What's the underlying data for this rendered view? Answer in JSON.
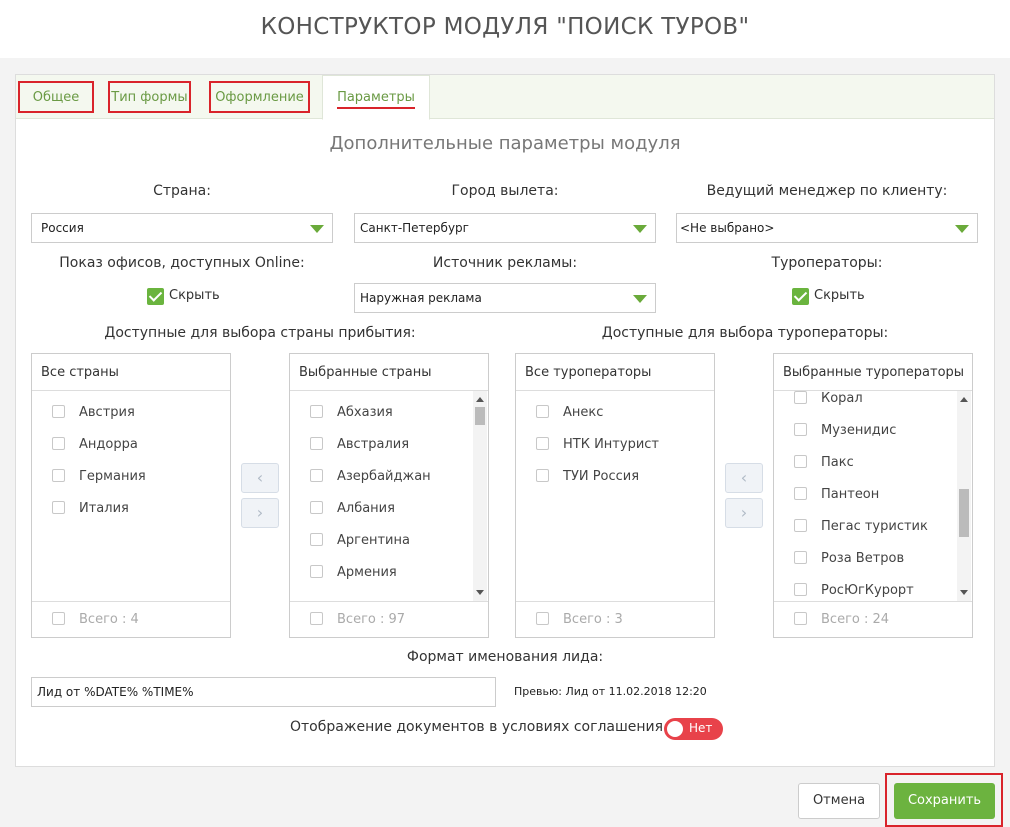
{
  "page_title": "КОНСТРУКТОР МОДУЛЯ \"ПОИСК ТУРОВ\"",
  "tabs": [
    {
      "label": "Общее",
      "active": false
    },
    {
      "label": "Тип формы",
      "active": false
    },
    {
      "label": "Оформление",
      "active": false
    },
    {
      "label": "Параметры",
      "active": true
    }
  ],
  "section_title": "Дополнительные параметры модуля",
  "fields": {
    "country": {
      "label": "Страна:",
      "value": "Россия"
    },
    "departure_city": {
      "label": "Город вылета:",
      "value": "Санкт-Петербург"
    },
    "manager": {
      "label": "Ведущий менеджер по клиенту:",
      "value": "<Не выбрано>"
    },
    "offices": {
      "label": "Показ офисов, доступных Online:",
      "checkbox_label": "Скрыть",
      "checked": true
    },
    "ad_source": {
      "label": "Источник рекламы:",
      "value": "Наружная реклама"
    },
    "operators": {
      "label": "Туроператоры:",
      "checkbox_label": "Скрыть",
      "checked": true
    }
  },
  "countries_group": {
    "label": "Доступные для выбора страны прибытия:",
    "all": {
      "title": "Все страны",
      "items": [
        "Австрия",
        "Андорра",
        "Германия",
        "Италия"
      ],
      "total": "Всего : 4"
    },
    "selected": {
      "title": "Выбранные страны",
      "items": [
        "Абхазия",
        "Австралия",
        "Азербайджан",
        "Албания",
        "Аргентина",
        "Армения"
      ],
      "total": "Всего : 97"
    }
  },
  "operators_group": {
    "label": "Доступные для выбора туроператоры:",
    "all": {
      "title": "Все туроператоры",
      "items": [
        "Анекс",
        "НТК Интурист",
        "ТУИ Россия"
      ],
      "total": "Всего : 3"
    },
    "selected": {
      "title": "Выбранные туроператоры",
      "items": [
        "Корал",
        "Музенидис",
        "Пакс",
        "Пантеон",
        "Пегас туристик",
        "Роза Ветров",
        "РосЮгКурорт"
      ],
      "total": "Всего : 24"
    }
  },
  "move_buttons": {
    "left": "‹",
    "right": "›"
  },
  "lead_format": {
    "label": "Формат именования лида:",
    "value": "Лид от %DATE% %TIME%",
    "preview": "Превью: Лид от 11.02.2018 12:20"
  },
  "documents": {
    "label": "Отображение документов в условиях соглашения",
    "toggle_label": "Нет"
  },
  "footer": {
    "cancel": "Отмена",
    "save": "Сохранить"
  },
  "colors": {
    "accent_green": "#6cb33f",
    "highlight_red": "#d9242b",
    "toggle_red": "#e8424a"
  }
}
